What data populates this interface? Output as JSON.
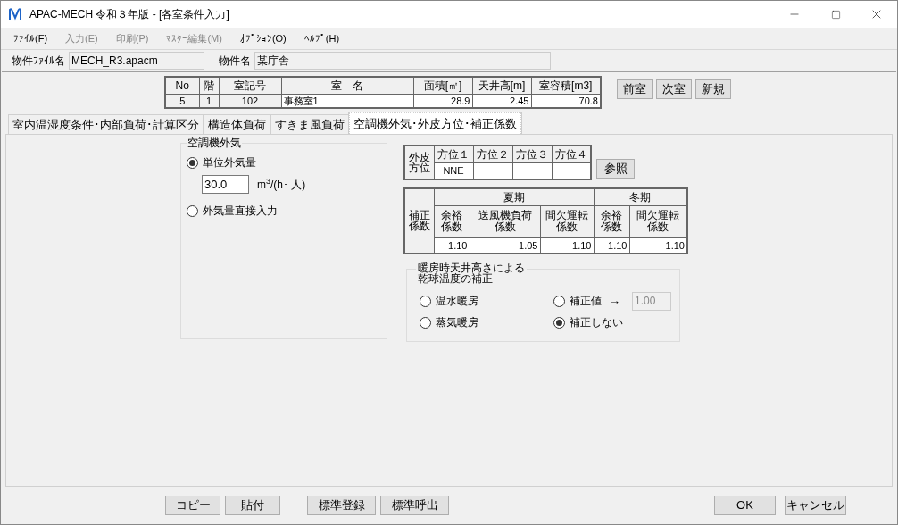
{
  "window": {
    "title": "APAC-MECH 令和３年版 - [各室条件入力]"
  },
  "menu": [
    {
      "label": "ﾌｧｲﾙ(F)",
      "disabled": false
    },
    {
      "label": "入力(E)",
      "disabled": true
    },
    {
      "label": "印刷(P)",
      "disabled": true
    },
    {
      "label": "ﾏｽﾀｰ編集(M)",
      "disabled": true
    },
    {
      "label": "ｵﾌﾟｼｮﾝ(O)",
      "disabled": false
    },
    {
      "label": "ﾍﾙﾌﾟ(H)",
      "disabled": false
    }
  ],
  "property": {
    "file_label": "物件ﾌｧｲﾙ名",
    "file_value": "MECH_R3.apacm",
    "name_label": "物件名",
    "name_value": "某庁舎"
  },
  "room_table": {
    "columns": [
      "No",
      "階",
      "室記号",
      "室　名",
      "面積[㎡]",
      "天井高[m]",
      "室容積[m3]"
    ],
    "rows": [
      [
        "5",
        "1",
        "102",
        "事務室1",
        "28.9",
        "2.45",
        "70.8"
      ]
    ]
  },
  "room_buttons": [
    "前室",
    "次室",
    "新規"
  ],
  "tabs": [
    {
      "label": "室内温湿度条件･内部負荷･計算区分",
      "selected": false
    },
    {
      "label": "構造体負荷",
      "selected": false
    },
    {
      "label": "すきま風負荷",
      "selected": false
    },
    {
      "label": "空調機外気･外皮方位･補正係数",
      "selected": true
    }
  ],
  "outdoor_air": {
    "title": "空調機外気",
    "options": [
      {
        "label": "単位外気量",
        "selected": true
      },
      {
        "label": "外気量直接入力",
        "selected": false
      }
    ],
    "value": "30.0",
    "unit": "m$^{3}$/(h･ 人)"
  },
  "orientation": {
    "row_header": "外皮方位",
    "columns": [
      "方位１",
      "方位２",
      "方位３",
      "方位４"
    ],
    "values": [
      "NNE"
    ]
  },
  "reference_button": "参照",
  "correction": {
    "row_header": "補正係数",
    "groups": [
      {
        "label": "夏期",
        "columns": [
          {
            "lines": [
              "余裕",
              "係数"
            ],
            "value": "1.10"
          },
          {
            "lines": [
              "送風機負荷",
              "係数"
            ],
            "value": "1.05"
          },
          {
            "lines": [
              "間欠運転",
              "係数"
            ],
            "value": "1.10"
          }
        ]
      },
      {
        "label": "冬期",
        "columns": [
          {
            "lines": [
              "余裕",
              "係数"
            ],
            "value": "1.10"
          },
          {
            "lines": [
              "間欠運転",
              "係数"
            ],
            "value": "1.10"
          }
        ]
      }
    ]
  },
  "heating": {
    "title_lines": [
      "暖房時天井高さによる",
      "乾球温度の補正"
    ],
    "options": [
      {
        "label": "温水暖房",
        "selected": false
      },
      {
        "label": "補正値",
        "selected": false
      },
      {
        "label": "蒸気暖房",
        "selected": false
      },
      {
        "label": "補正しない",
        "selected": true
      }
    ],
    "arrow": "→",
    "correction_value": "1.00",
    "correction_disabled": true
  },
  "bottom_left": [
    [
      "コピー",
      "貼付"
    ],
    [
      "標準登録",
      "標準呼出"
    ]
  ],
  "bottom_right": [
    "OK",
    "キャンセル"
  ]
}
